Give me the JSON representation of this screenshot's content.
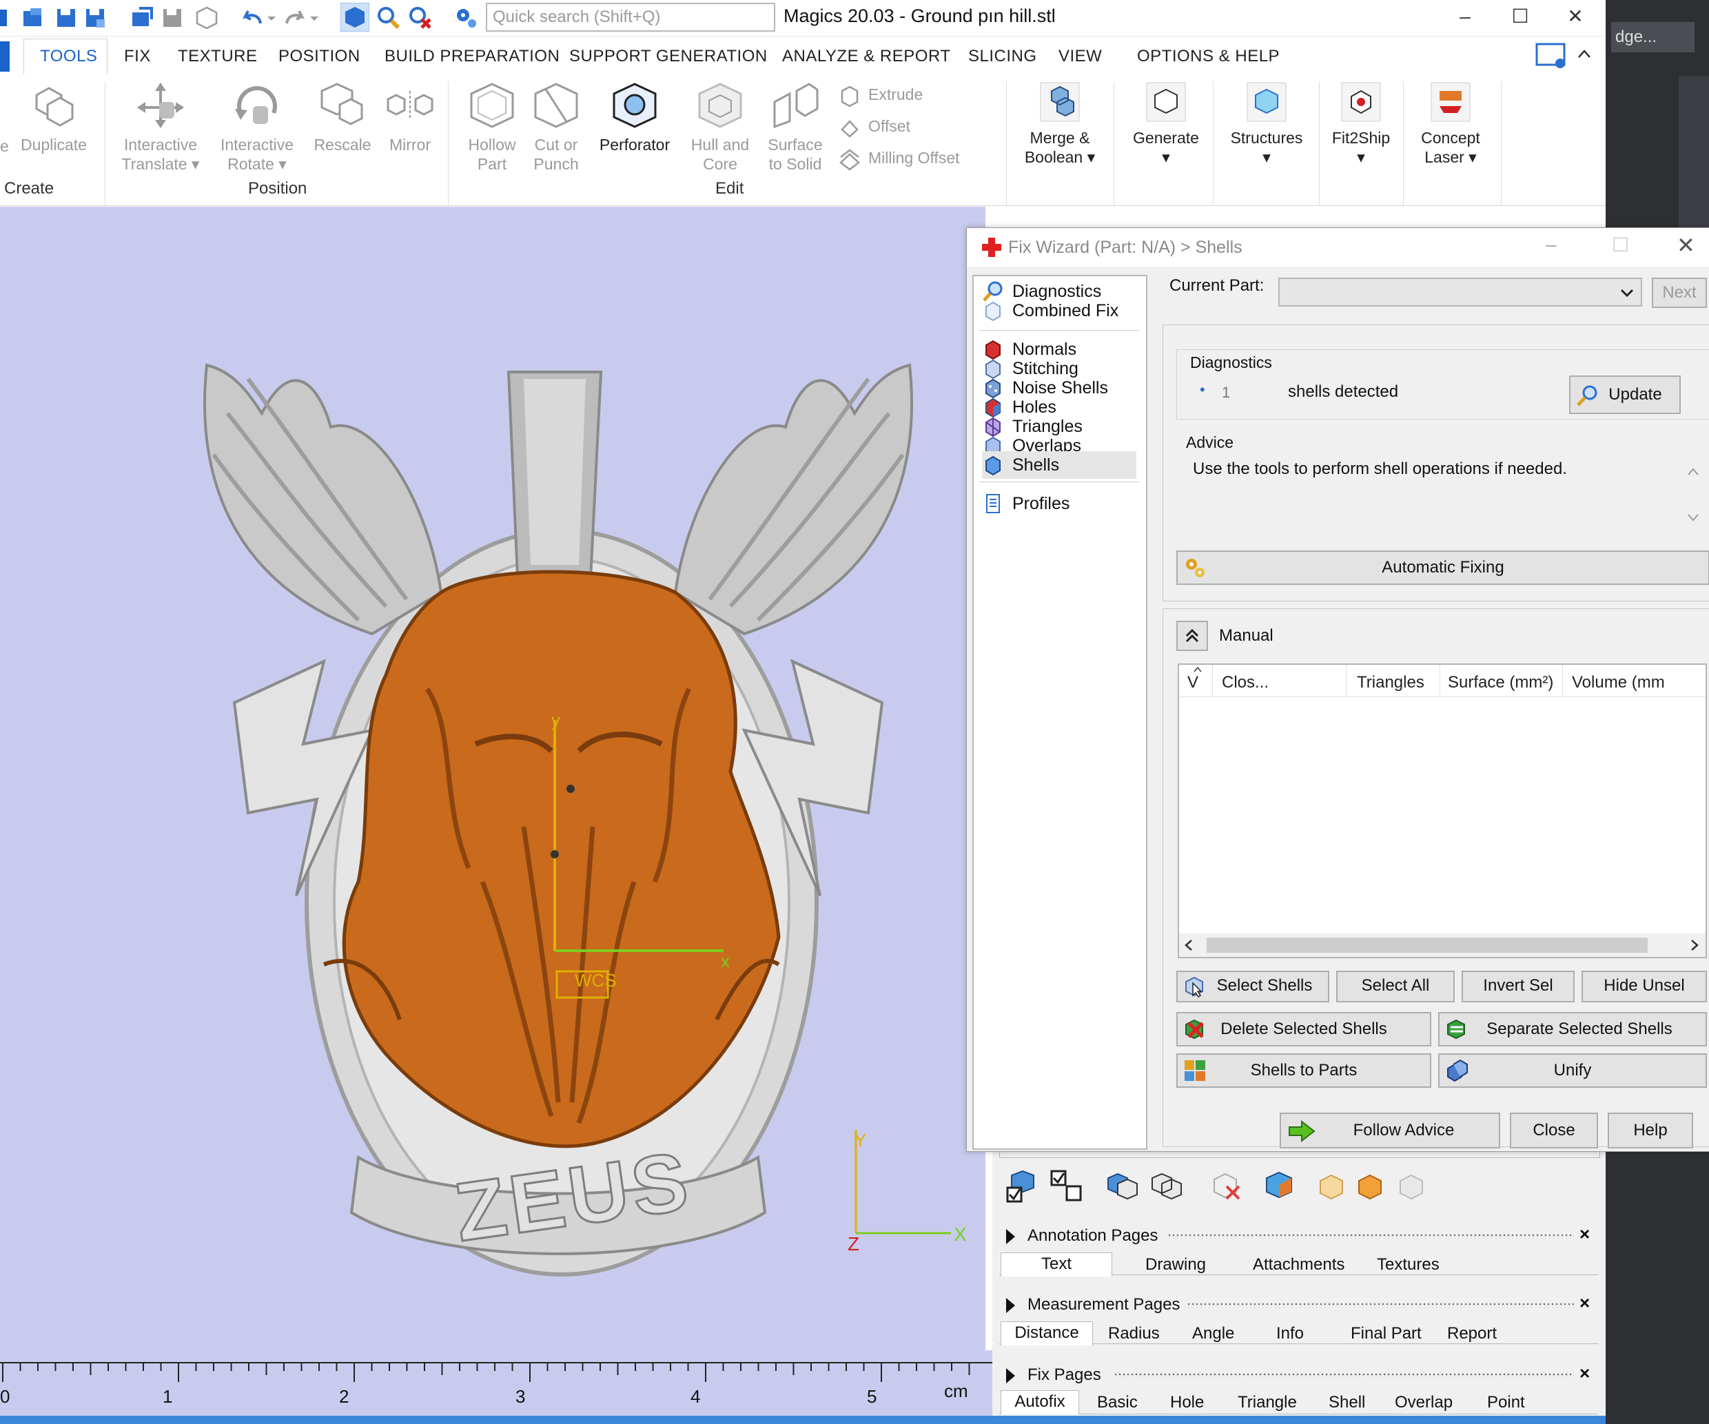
{
  "titlebar": {
    "search_placeholder": "Quick search (Shift+Q)",
    "app_title": "Magics 20.03 - Ground pın hill.stl",
    "minimize": "–",
    "maximize": "☐",
    "close": "✕",
    "side_window_label": "dge..."
  },
  "ribbon_tabs": [
    "TOOLS",
    "FIX",
    "TEXTURE",
    "POSITION",
    "BUILD PREPARATION",
    "SUPPORT GENERATION",
    "ANALYZE & REPORT",
    "SLICING",
    "VIEW",
    "OPTIONS & HELP"
  ],
  "ribbon": {
    "create": {
      "duplicate": "Duplicate",
      "group": "Create",
      "partial": "e"
    },
    "position": {
      "translate_1": "Interactive",
      "translate_2": "Translate",
      "rotate_1": "Interactive",
      "rotate_2": "Rotate",
      "rescale": "Rescale",
      "mirror": "Mirror",
      "group": "Position"
    },
    "edit": {
      "hollow_1": "Hollow",
      "hollow_2": "Part",
      "cut_1": "Cut or",
      "cut_2": "Punch",
      "perforator": "Perforator",
      "hull_1": "Hull and",
      "hull_2": "Core",
      "surface_1": "Surface",
      "surface_2": "to Solid",
      "extrude": "Extrude",
      "offset": "Offset",
      "milling": "Milling Offset",
      "group": "Edit"
    },
    "merge_1": "Merge &",
    "merge_2": "Boolean",
    "generate": "Generate",
    "structures": "Structures",
    "fit2ship": "Fit2Ship",
    "concept_1": "Concept",
    "concept_2": "Laser"
  },
  "viewport": {
    "wcs_label": "WCS",
    "axis_y": "y",
    "axis_x": "x",
    "corner_y": "Y",
    "corner_x": "X",
    "corner_z": "Z",
    "model_text": "ZEUS",
    "ruler_labels": [
      "0",
      "1",
      "2",
      "3",
      "4",
      "5"
    ],
    "ruler_unit": "cm"
  },
  "wizard": {
    "title": "Fix Wizard (Part: N/A) > Shells",
    "nav": {
      "diagnostics": "Diagnostics",
      "combined_fix": "Combined Fix",
      "normals": "Normals",
      "stitching": "Stitching",
      "noise_shells": "Noise Shells",
      "holes": "Holes",
      "triangles": "Triangles",
      "overlaps": "Overlaps",
      "shells": "Shells",
      "profiles": "Profiles"
    },
    "current_part_label": "Current Part:",
    "current_part_value": "",
    "next_button": "Next",
    "diagnostics_label": "Diagnostics",
    "diag_count": "1",
    "diag_text": "shells detected",
    "update_button": "Update",
    "advice_label": "Advice",
    "advice_text": "Use the tools to perform shell operations if needed.",
    "automatic_fixing": "Automatic Fixing",
    "manual_label": "Manual",
    "table_headers": [
      "V",
      "Clos...",
      "Triangles",
      "Surface (mm²)",
      "Volume (mm"
    ],
    "buttons": {
      "select_shells": "Select Shells",
      "select_all": "Select All",
      "invert_sel": "Invert Sel",
      "hide_unsel": "Hide Unsel",
      "delete_selected": "Delete Selected Shells",
      "separate_selected": "Separate Selected Shells",
      "shells_to_parts": "Shells to Parts",
      "unify": "Unify",
      "follow_advice": "Follow Advice",
      "close": "Close",
      "help": "Help"
    }
  },
  "pages": {
    "annotation": {
      "header": "Annotation Pages",
      "tabs": [
        "Text",
        "Drawing",
        "Attachments",
        "Textures"
      ]
    },
    "measurement": {
      "header": "Measurement Pages",
      "tabs": [
        "Distance",
        "Radius",
        "Angle",
        "Info",
        "Final Part",
        "Report"
      ]
    },
    "fix": {
      "header": "Fix Pages",
      "tabs": [
        "Autofix",
        "Basic",
        "Hole",
        "Triangle",
        "Shell",
        "Overlap",
        "Point"
      ]
    },
    "close_glyph": "×"
  },
  "colors": {
    "accent_blue": "#1a63c8",
    "viewport_bg": "#c9cbee",
    "model_orange": "#c96a1c",
    "model_silver": "#bfbfbf",
    "statusbar": "#3a86d8"
  }
}
